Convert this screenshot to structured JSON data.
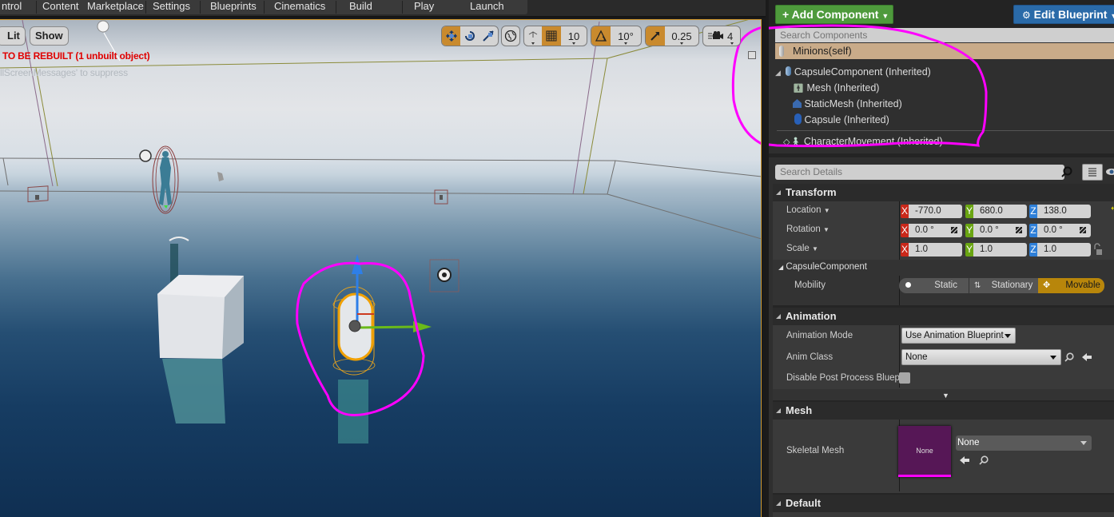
{
  "toolbar": {
    "items": [
      "ntrol",
      "Content",
      "Marketplace",
      "Settings",
      "Blueprints",
      "Cinematics",
      "Build",
      "Play",
      "Launch"
    ]
  },
  "viewport": {
    "lit_label": "Lit",
    "show_label": "Show",
    "warning": "TO BE REBUILT (1 unbuilt object)",
    "suppress_hint": "llScreenMessages' to suppress",
    "grid_snap_value": "10",
    "rotation_snap_value": "10°",
    "scale_snap_value": "0.25",
    "camera_speed_value": "4",
    "annotation_color": "#ff00ff"
  },
  "components": {
    "add_button": "Add Component",
    "edit_button": "Edit Blueprint",
    "search_placeholder": "Search Components",
    "self_label": "Minions(self)",
    "tree": [
      {
        "label": "CapsuleComponent (Inherited)",
        "icon": "capsule-icon"
      },
      {
        "label": "Mesh (Inherited)",
        "icon": "skeletal-mesh-icon"
      },
      {
        "label": "StaticMesh (Inherited)",
        "icon": "static-mesh-icon"
      },
      {
        "label": "Capsule (Inherited)",
        "icon": "capsule-icon"
      },
      {
        "label": "CharacterMovement (Inherited)",
        "icon": "character-movement-icon"
      }
    ]
  },
  "details": {
    "search_placeholder": "Search Details",
    "transform": {
      "title": "Transform",
      "location_label": "Location",
      "rotation_label": "Rotation",
      "scale_label": "Scale",
      "location": {
        "x": "-770.0",
        "y": "680.0",
        "z": "138.0"
      },
      "rotation": {
        "x": "0.0 °",
        "y": "0.0 °",
        "z": "0.0 °"
      },
      "scale": {
        "x": "1.0",
        "y": "1.0",
        "z": "1.0"
      },
      "axis_labels": {
        "x": "X",
        "y": "Y",
        "z": "Z"
      }
    },
    "capsule": {
      "title": "CapsuleComponent",
      "mobility_label": "Mobility",
      "mobility_options": [
        "Static",
        "Stationary",
        "Movable"
      ],
      "mobility_selected": "Movable"
    },
    "animation": {
      "title": "Animation",
      "mode_label": "Animation Mode",
      "mode_value": "Use Animation Blueprint",
      "class_label": "Anim Class",
      "class_value": "None",
      "disable_pp_label": "Disable Post Process Bluep",
      "disable_pp_checked": false
    },
    "mesh": {
      "title": "Mesh",
      "skeletal_label": "Skeletal Mesh",
      "thumbnail_label": "None",
      "skeletal_value": "None"
    },
    "default": {
      "title": "Default"
    }
  }
}
